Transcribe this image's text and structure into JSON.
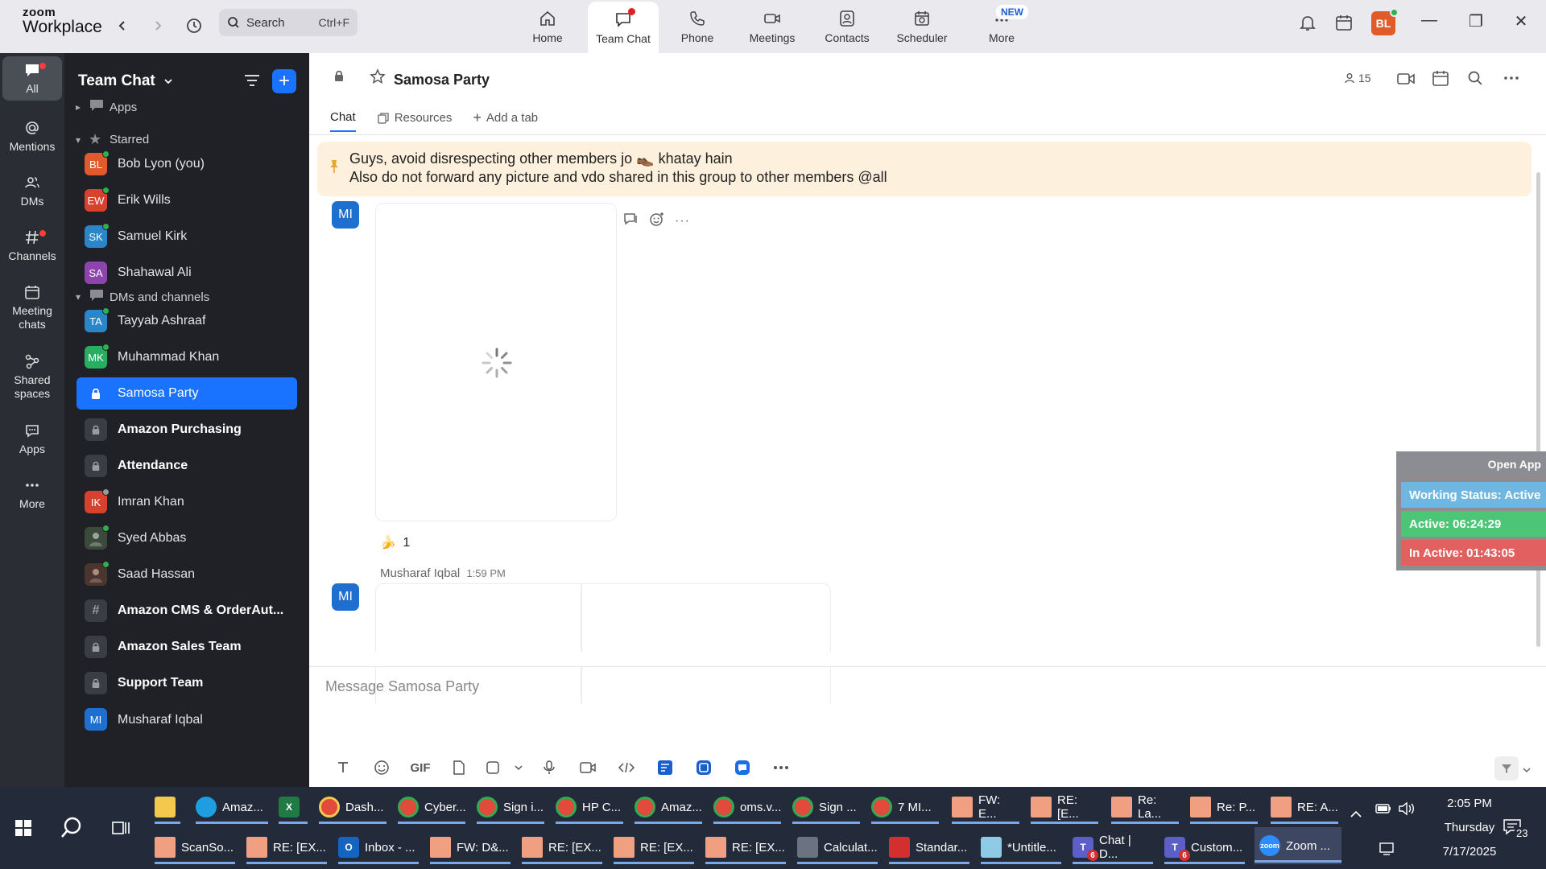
{
  "app": {
    "brand_line1": "zoom",
    "brand_line2": "Workplace"
  },
  "search": {
    "placeholder": "Search",
    "shortcut": "Ctrl+F"
  },
  "nav": {
    "tabs": [
      {
        "label": "Home"
      },
      {
        "label": "Team Chat"
      },
      {
        "label": "Phone"
      },
      {
        "label": "Meetings"
      },
      {
        "label": "Contacts"
      },
      {
        "label": "Scheduler"
      },
      {
        "label": "More"
      }
    ],
    "new_badge": "NEW"
  },
  "user": {
    "initials": "BL",
    "avatar_color": "#e05a2a"
  },
  "rail": {
    "items": [
      {
        "label": "All"
      },
      {
        "label": "Mentions"
      },
      {
        "label": "DMs"
      },
      {
        "label": "Channels"
      },
      {
        "label": "Meeting chats"
      },
      {
        "label": "Shared spaces"
      },
      {
        "label": "Apps"
      },
      {
        "label": "More"
      }
    ]
  },
  "sidebar": {
    "title": "Team Chat",
    "sections": {
      "apps": "Apps",
      "starred": "Starred",
      "dms": "DMs and channels"
    },
    "starred": [
      {
        "initials": "BL",
        "name": "Bob Lyon (you)",
        "color": "#e05a2a"
      },
      {
        "initials": "EW",
        "name": "Erik Wills",
        "color": "#d9412f"
      },
      {
        "initials": "SK",
        "name": "Samuel Kirk",
        "color": "#2a86c9"
      },
      {
        "initials": "SA",
        "name": "Shahawal Ali",
        "color": "#8e44ad"
      }
    ],
    "channels": [
      {
        "initials": "TA",
        "name": "Tayyab Ashraaf",
        "color": "#2a86c9"
      },
      {
        "initials": "MK",
        "name": "Muhammad Khan",
        "color": "#27ae60"
      },
      {
        "name": "Samosa Party"
      },
      {
        "name": "Amazon Purchasing"
      },
      {
        "name": "Attendance"
      },
      {
        "initials": "IK",
        "name": "Imran Khan",
        "color": "#d9412f"
      },
      {
        "name": "Syed Abbas"
      },
      {
        "name": "Saad Hassan"
      },
      {
        "name": "Amazon CMS & OrderAut..."
      },
      {
        "name": "Amazon Sales Team"
      },
      {
        "name": "Support Team"
      },
      {
        "initials": "MI",
        "name": "Musharaf Iqbal",
        "color": "#1f6fd1"
      }
    ]
  },
  "channel": {
    "title": "Samosa Party",
    "member_count": "15",
    "tabs": {
      "chat": "Chat",
      "resources": "Resources",
      "add": "Add a tab"
    },
    "pinned_line1": "Guys, avoid disrespecting other members jo 👞 khatay hain",
    "pinned_line2": "Also do not forward any picture and vdo shared in this group to other members @all"
  },
  "messages": {
    "avatar_initials": "MI",
    "reaction_emoji": "🍌",
    "reaction_count": "1",
    "sender": "Musharaf Iqbal",
    "time": "1:59 PM"
  },
  "composer": {
    "placeholder": "Message Samosa Party"
  },
  "widget": {
    "open_app": "Open App",
    "working_status": "Working Status: Active",
    "active": "Active: 06:24:29",
    "inactive": "In Active: 01:43:05"
  },
  "taskbar": {
    "row1": [
      {
        "label": ""
      },
      {
        "label": "Amaz..."
      },
      {
        "label": ""
      },
      {
        "label": "Dash..."
      },
      {
        "label": "Cyber..."
      },
      {
        "label": "Sign i..."
      },
      {
        "label": "HP C..."
      },
      {
        "label": "Amaz..."
      },
      {
        "label": "oms.v..."
      },
      {
        "label": "Sign ..."
      },
      {
        "label": "7 MI..."
      },
      {
        "label": "FW: E..."
      },
      {
        "label": "RE: [E..."
      },
      {
        "label": "Re: La..."
      },
      {
        "label": "Re: P..."
      },
      {
        "label": "RE: A..."
      }
    ],
    "row2": [
      {
        "label": "ScanSo..."
      },
      {
        "label": "RE: [EX..."
      },
      {
        "label": "Inbox - ..."
      },
      {
        "label": "FW: D&..."
      },
      {
        "label": "RE: [EX..."
      },
      {
        "label": "RE: [EX..."
      },
      {
        "label": "RE: [EX..."
      },
      {
        "label": "Calculat..."
      },
      {
        "label": "Standar..."
      },
      {
        "label": "*Untitle..."
      },
      {
        "label": "Chat | D..."
      },
      {
        "label": "Custom..."
      },
      {
        "label": "Zoom ..."
      }
    ],
    "badge_6": "6",
    "clock": {
      "time": "2:05 PM",
      "day": "Thursday",
      "date": "7/17/2025"
    },
    "notif_count": "23"
  }
}
